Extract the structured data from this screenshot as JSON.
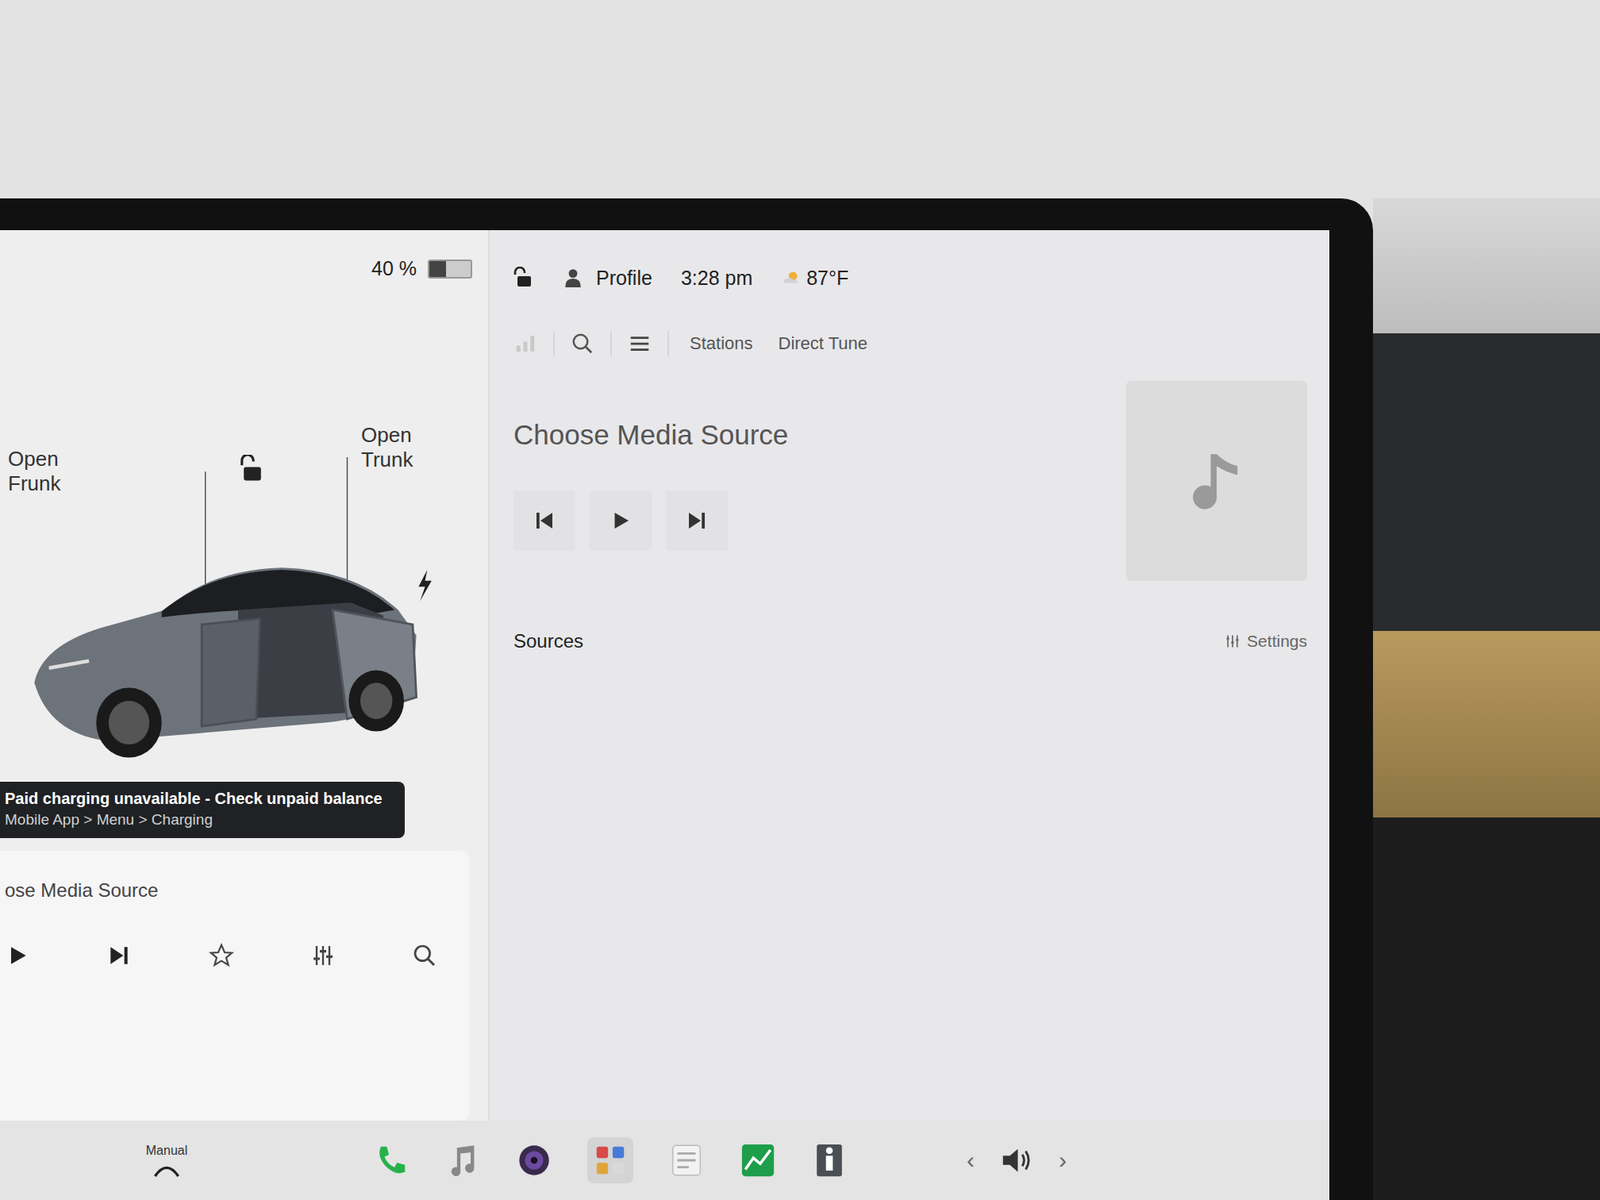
{
  "status_bar": {
    "battery": "40 %",
    "battery_level": 0.4,
    "locked": false,
    "profile": "Profile",
    "time": "3:28 pm",
    "temperature": "87°F"
  },
  "car_panel": {
    "frunk_label": "Open Frunk",
    "trunk_label": "Open Trunk",
    "locked": false,
    "charging": true,
    "alert": {
      "title": "Paid charging unavailable - Check unpaid balance",
      "detail": "Mobile App > Menu > Charging"
    }
  },
  "mini_player": {
    "title": "ose Media Source"
  },
  "media": {
    "tabs": [
      {
        "label": "Stations",
        "selected": false
      },
      {
        "label": "Direct Tune",
        "selected": false
      }
    ],
    "title": "Choose Media Source",
    "sources_label": "Sources",
    "settings_label": "Settings"
  },
  "taskbar": {
    "drive_label": "Manual",
    "volume_prev": "‹",
    "volume_next": "›"
  }
}
